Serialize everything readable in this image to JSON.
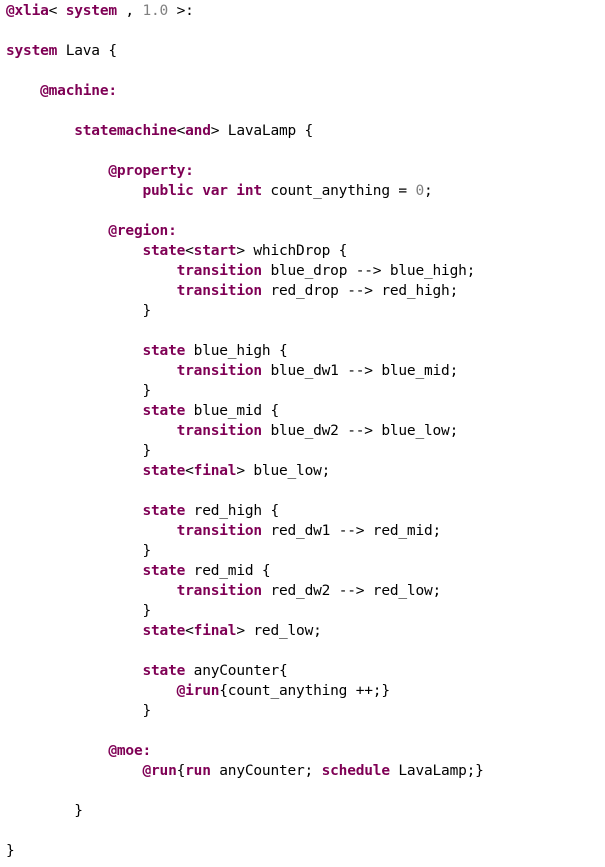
{
  "colors": {
    "keyword": "#7f0055",
    "number": "#808080",
    "text": "#000000",
    "background": "#ffffff"
  },
  "lines": [
    {
      "indent": 0,
      "tokens": [
        {
          "k": "kw",
          "t": "@xlia"
        },
        {
          "k": "plain",
          "t": "< "
        },
        {
          "k": "kw",
          "t": "system"
        },
        {
          "k": "plain",
          "t": " , "
        },
        {
          "k": "num",
          "t": "1.0"
        },
        {
          "k": "plain",
          "t": " >:"
        }
      ]
    },
    {
      "indent": 0,
      "tokens": []
    },
    {
      "indent": 0,
      "tokens": [
        {
          "k": "kw",
          "t": "system"
        },
        {
          "k": "plain",
          "t": " Lava {"
        }
      ]
    },
    {
      "indent": 0,
      "tokens": []
    },
    {
      "indent": 4,
      "tokens": [
        {
          "k": "kw",
          "t": "@machine:"
        }
      ]
    },
    {
      "indent": 0,
      "tokens": []
    },
    {
      "indent": 8,
      "tokens": [
        {
          "k": "kw",
          "t": "statemachine"
        },
        {
          "k": "plain",
          "t": "<"
        },
        {
          "k": "kw",
          "t": "and"
        },
        {
          "k": "plain",
          "t": "> LavaLamp {"
        }
      ]
    },
    {
      "indent": 0,
      "tokens": []
    },
    {
      "indent": 12,
      "tokens": [
        {
          "k": "kw",
          "t": "@property:"
        }
      ]
    },
    {
      "indent": 16,
      "tokens": [
        {
          "k": "kw",
          "t": "public var int"
        },
        {
          "k": "plain",
          "t": " count_anything = "
        },
        {
          "k": "num",
          "t": "0"
        },
        {
          "k": "plain",
          "t": ";"
        }
      ]
    },
    {
      "indent": 0,
      "tokens": []
    },
    {
      "indent": 12,
      "tokens": [
        {
          "k": "kw",
          "t": "@region:"
        }
      ]
    },
    {
      "indent": 16,
      "tokens": [
        {
          "k": "kw",
          "t": "state"
        },
        {
          "k": "plain",
          "t": "<"
        },
        {
          "k": "kw",
          "t": "start"
        },
        {
          "k": "plain",
          "t": "> whichDrop {"
        }
      ]
    },
    {
      "indent": 20,
      "tokens": [
        {
          "k": "kw",
          "t": "transition"
        },
        {
          "k": "plain",
          "t": " blue_drop --> blue_high;"
        }
      ]
    },
    {
      "indent": 20,
      "tokens": [
        {
          "k": "kw",
          "t": "transition"
        },
        {
          "k": "plain",
          "t": " red_drop --> red_high;"
        }
      ]
    },
    {
      "indent": 16,
      "tokens": [
        {
          "k": "plain",
          "t": "}"
        }
      ]
    },
    {
      "indent": 0,
      "tokens": []
    },
    {
      "indent": 16,
      "tokens": [
        {
          "k": "kw",
          "t": "state"
        },
        {
          "k": "plain",
          "t": " blue_high {"
        }
      ]
    },
    {
      "indent": 20,
      "tokens": [
        {
          "k": "kw",
          "t": "transition"
        },
        {
          "k": "plain",
          "t": " blue_dw1 --> blue_mid;"
        }
      ]
    },
    {
      "indent": 16,
      "tokens": [
        {
          "k": "plain",
          "t": "}"
        }
      ]
    },
    {
      "indent": 16,
      "tokens": [
        {
          "k": "kw",
          "t": "state"
        },
        {
          "k": "plain",
          "t": " blue_mid {"
        }
      ]
    },
    {
      "indent": 20,
      "tokens": [
        {
          "k": "kw",
          "t": "transition"
        },
        {
          "k": "plain",
          "t": " blue_dw2 --> blue_low;"
        }
      ]
    },
    {
      "indent": 16,
      "tokens": [
        {
          "k": "plain",
          "t": "}"
        }
      ]
    },
    {
      "indent": 16,
      "tokens": [
        {
          "k": "kw",
          "t": "state"
        },
        {
          "k": "plain",
          "t": "<"
        },
        {
          "k": "kw",
          "t": "final"
        },
        {
          "k": "plain",
          "t": "> blue_low;"
        }
      ]
    },
    {
      "indent": 0,
      "tokens": []
    },
    {
      "indent": 16,
      "tokens": [
        {
          "k": "kw",
          "t": "state"
        },
        {
          "k": "plain",
          "t": " red_high {"
        }
      ]
    },
    {
      "indent": 20,
      "tokens": [
        {
          "k": "kw",
          "t": "transition"
        },
        {
          "k": "plain",
          "t": " red_dw1 --> red_mid;"
        }
      ]
    },
    {
      "indent": 16,
      "tokens": [
        {
          "k": "plain",
          "t": "}"
        }
      ]
    },
    {
      "indent": 16,
      "tokens": [
        {
          "k": "kw",
          "t": "state"
        },
        {
          "k": "plain",
          "t": " red_mid {"
        }
      ]
    },
    {
      "indent": 20,
      "tokens": [
        {
          "k": "kw",
          "t": "transition"
        },
        {
          "k": "plain",
          "t": " red_dw2 --> red_low;"
        }
      ]
    },
    {
      "indent": 16,
      "tokens": [
        {
          "k": "plain",
          "t": "}"
        }
      ]
    },
    {
      "indent": 16,
      "tokens": [
        {
          "k": "kw",
          "t": "state"
        },
        {
          "k": "plain",
          "t": "<"
        },
        {
          "k": "kw",
          "t": "final"
        },
        {
          "k": "plain",
          "t": "> red_low;"
        }
      ]
    },
    {
      "indent": 0,
      "tokens": []
    },
    {
      "indent": 16,
      "tokens": [
        {
          "k": "kw",
          "t": "state"
        },
        {
          "k": "plain",
          "t": " anyCounter{"
        }
      ]
    },
    {
      "indent": 20,
      "tokens": [
        {
          "k": "kw",
          "t": "@irun"
        },
        {
          "k": "plain",
          "t": "{count_anything ++;}"
        }
      ]
    },
    {
      "indent": 16,
      "tokens": [
        {
          "k": "plain",
          "t": "}"
        }
      ]
    },
    {
      "indent": 0,
      "tokens": []
    },
    {
      "indent": 12,
      "tokens": [
        {
          "k": "kw",
          "t": "@moe:"
        }
      ]
    },
    {
      "indent": 16,
      "tokens": [
        {
          "k": "kw",
          "t": "@run"
        },
        {
          "k": "plain",
          "t": "{"
        },
        {
          "k": "kw",
          "t": "run"
        },
        {
          "k": "plain",
          "t": " anyCounter; "
        },
        {
          "k": "kw",
          "t": "schedule"
        },
        {
          "k": "plain",
          "t": " LavaLamp;}"
        }
      ]
    },
    {
      "indent": 0,
      "tokens": []
    },
    {
      "indent": 8,
      "tokens": [
        {
          "k": "plain",
          "t": "}"
        }
      ]
    },
    {
      "indent": 0,
      "tokens": []
    },
    {
      "indent": 0,
      "tokens": [
        {
          "k": "plain",
          "t": "}"
        }
      ]
    }
  ]
}
